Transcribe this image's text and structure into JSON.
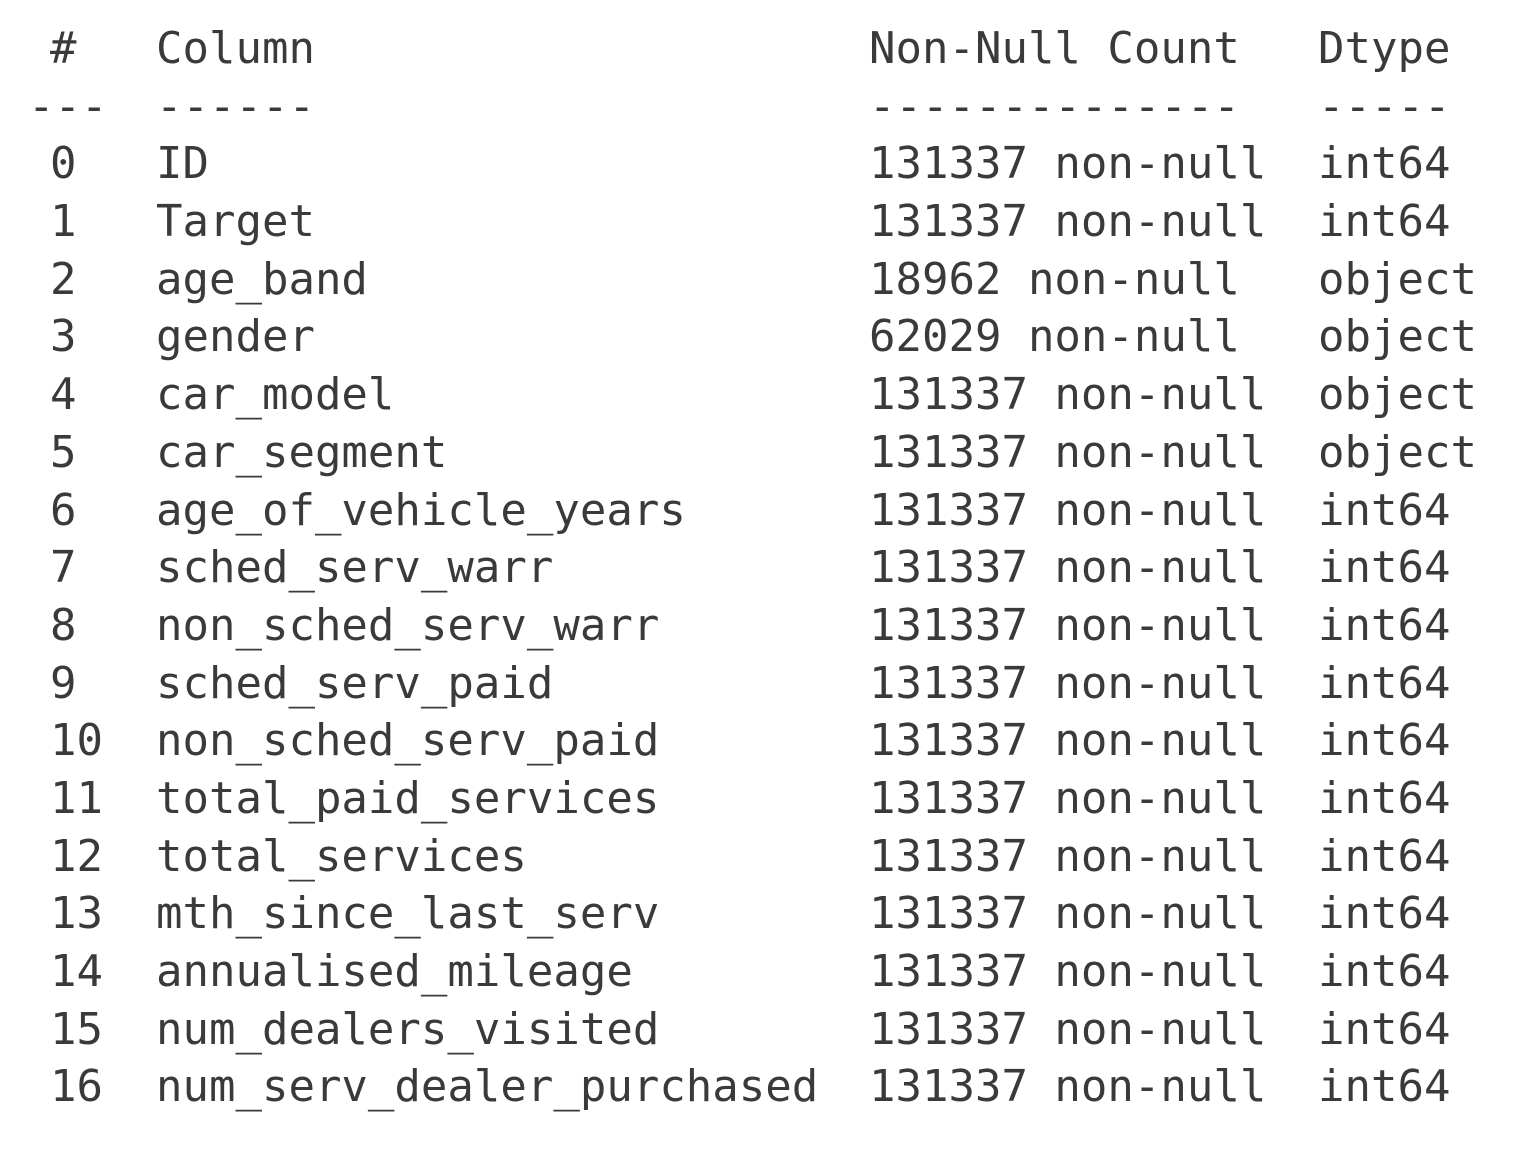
{
  "header": {
    "index": "#",
    "column": "Column",
    "count": "Non-Null Count",
    "dtype": "Dtype"
  },
  "separator": {
    "index": "---",
    "column": "------",
    "count": "--------------",
    "dtype": "-----"
  },
  "rows": [
    {
      "index": "0",
      "column": "ID",
      "count": "131337 non-null",
      "dtype": "int64"
    },
    {
      "index": "1",
      "column": "Target",
      "count": "131337 non-null",
      "dtype": "int64"
    },
    {
      "index": "2",
      "column": "age_band",
      "count": "18962 non-null",
      "dtype": "object"
    },
    {
      "index": "3",
      "column": "gender",
      "count": "62029 non-null",
      "dtype": "object"
    },
    {
      "index": "4",
      "column": "car_model",
      "count": "131337 non-null",
      "dtype": "object"
    },
    {
      "index": "5",
      "column": "car_segment",
      "count": "131337 non-null",
      "dtype": "object"
    },
    {
      "index": "6",
      "column": "age_of_vehicle_years",
      "count": "131337 non-null",
      "dtype": "int64"
    },
    {
      "index": "7",
      "column": "sched_serv_warr",
      "count": "131337 non-null",
      "dtype": "int64"
    },
    {
      "index": "8",
      "column": "non_sched_serv_warr",
      "count": "131337 non-null",
      "dtype": "int64"
    },
    {
      "index": "9",
      "column": "sched_serv_paid",
      "count": "131337 non-null",
      "dtype": "int64"
    },
    {
      "index": "10",
      "column": "non_sched_serv_paid",
      "count": "131337 non-null",
      "dtype": "int64"
    },
    {
      "index": "11",
      "column": "total_paid_services",
      "count": "131337 non-null",
      "dtype": "int64"
    },
    {
      "index": "12",
      "column": "total_services",
      "count": "131337 non-null",
      "dtype": "int64"
    },
    {
      "index": "13",
      "column": "mth_since_last_serv",
      "count": "131337 non-null",
      "dtype": "int64"
    },
    {
      "index": "14",
      "column": "annualised_mileage",
      "count": "131337 non-null",
      "dtype": "int64"
    },
    {
      "index": "15",
      "column": "num_dealers_visited",
      "count": "131337 non-null",
      "dtype": "int64"
    },
    {
      "index": "16",
      "column": "num_serv_dealer_purchased",
      "count": "131337 non-null",
      "dtype": "int64"
    }
  ]
}
